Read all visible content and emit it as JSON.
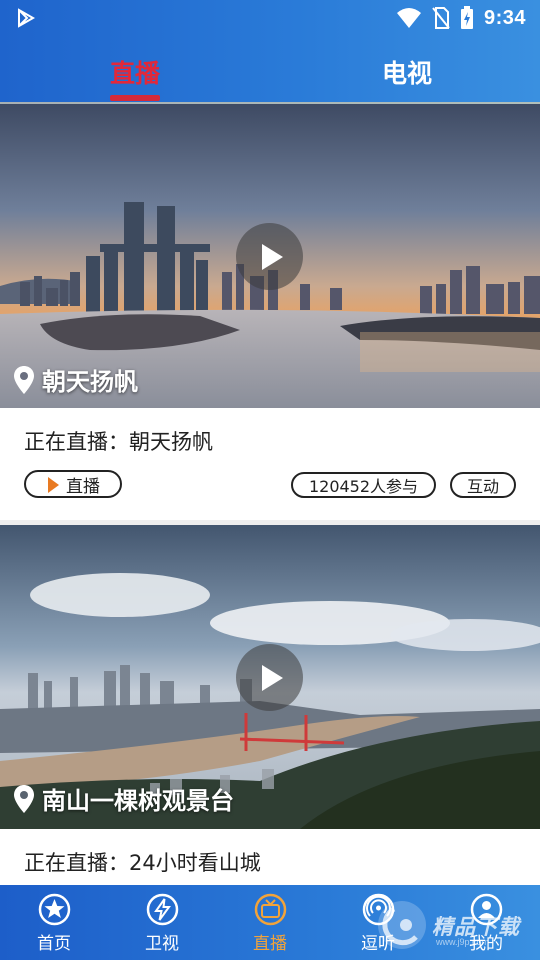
{
  "status_bar": {
    "time": "9:34"
  },
  "tabs": [
    {
      "label": "直播",
      "active": true
    },
    {
      "label": "电视",
      "active": false
    }
  ],
  "channels": [
    {
      "location": "朝天扬帆",
      "now_playing": "正在直播：朝天扬帆",
      "live_label": "直播",
      "participants": "120452人参与",
      "interact_label": "互动"
    },
    {
      "location": "南山一棵树观景台",
      "now_playing": "正在直播：24小时看山城"
    }
  ],
  "bottom_nav": [
    {
      "label": "首页",
      "icon": "star-icon"
    },
    {
      "label": "卫视",
      "icon": "lightning-icon"
    },
    {
      "label": "直播",
      "icon": "tv-icon",
      "active": true
    },
    {
      "label": "逗听",
      "icon": "radio-icon"
    },
    {
      "label": "我的",
      "icon": "user-icon"
    }
  ],
  "watermark": {
    "text": "精品下载",
    "sub": "www.j9p.com"
  },
  "colors": {
    "header_blue": "#2a7bd8",
    "active_tab_red": "#e2283a",
    "active_nav_orange": "#f2a33a",
    "live_triangle_orange": "#e87a22"
  }
}
